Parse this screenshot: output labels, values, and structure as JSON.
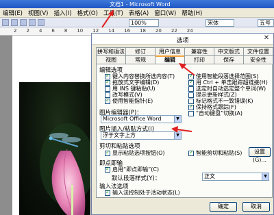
{
  "window": {
    "title": "文档1 - Microsoft Word"
  },
  "menubar": {
    "items": [
      "编辑(E)",
      "视图(V)",
      "插入(I)",
      "格式(O)",
      "工具(T)",
      "表格(A)",
      "窗口(W)",
      "帮助(H)"
    ]
  },
  "toolbar": {
    "zoom": "100%",
    "font_name": "宋体",
    "font_size": "五号"
  },
  "ruler": {
    "marks": [
      "2",
      "2",
      "4",
      "6",
      "8",
      "10",
      "12",
      "14",
      "16",
      "18",
      "20",
      "22",
      "24"
    ]
  },
  "dialog": {
    "title": "选项",
    "tabs_row1": [
      "拼写和语法",
      "修订",
      "用户信息",
      "兼容性",
      "中文版式",
      "文件位置"
    ],
    "tabs_row2": [
      "视图",
      "常规",
      "编辑",
      "打印",
      "保存",
      "安全性"
    ],
    "active_tab": "编辑",
    "editing_section": "编辑选项",
    "left_options": [
      {
        "label": "键入内容替换所选内容(T)",
        "checked": true
      },
      {
        "label": "拖放式文字编辑(D)",
        "checked": true
      },
      {
        "label": "用 INS 键粘贴(U)",
        "checked": false
      },
      {
        "label": "改写模式(V)",
        "checked": false
      },
      {
        "label": "使用智能指针(E)",
        "checked": true
      }
    ],
    "right_options": [
      {
        "label": "使用智能段落选择范围(S)",
        "checked": true
      },
      {
        "label": "用 Ctrl + 单击跟踪超链接(H)",
        "checked": true
      },
      {
        "label": "选定时自动选定整个单词(W)",
        "checked": false
      },
      {
        "label": "提示更新样式(Z)",
        "checked": false
      },
      {
        "label": "标记格式不一致错误(K)",
        "checked": false
      },
      {
        "label": "保持格式跟踪(F)",
        "checked": true
      },
      {
        "label": "“自动键盘”切换(A)",
        "checked": false
      }
    ],
    "picture_editor_label": "图片编辑器(P)：",
    "picture_editor_value": "Microsoft Office Word",
    "insert_paste_label": "图片插入/粘贴方式(I)",
    "insert_paste_value": "浮于文字上方",
    "cut_paste_section": "剪切和粘贴选项",
    "show_paste_buttons": {
      "label": "显示粘贴选项按钮(O)",
      "checked": true
    },
    "smart_cut_paste": {
      "label": "智能剪切和粘贴(S)",
      "checked": true
    },
    "settings_button": "设置(G)...",
    "click_type_section": "即点即输",
    "enable_click_type": {
      "label": "启用“即点即输”(C)",
      "checked": true
    },
    "default_style_label": "默认段落样式(Y)：",
    "default_style_value": "正文",
    "ime_section": "输入法选项",
    "ime_option": {
      "label": "输入法控制处于活动状态(L)",
      "checked": true
    },
    "ok_button": "确定",
    "cancel_button": "取消"
  },
  "colors": {
    "accent_arrow": "#e02020",
    "dialog_bg": "#ece9d8",
    "title_blue": "#2057c5"
  }
}
